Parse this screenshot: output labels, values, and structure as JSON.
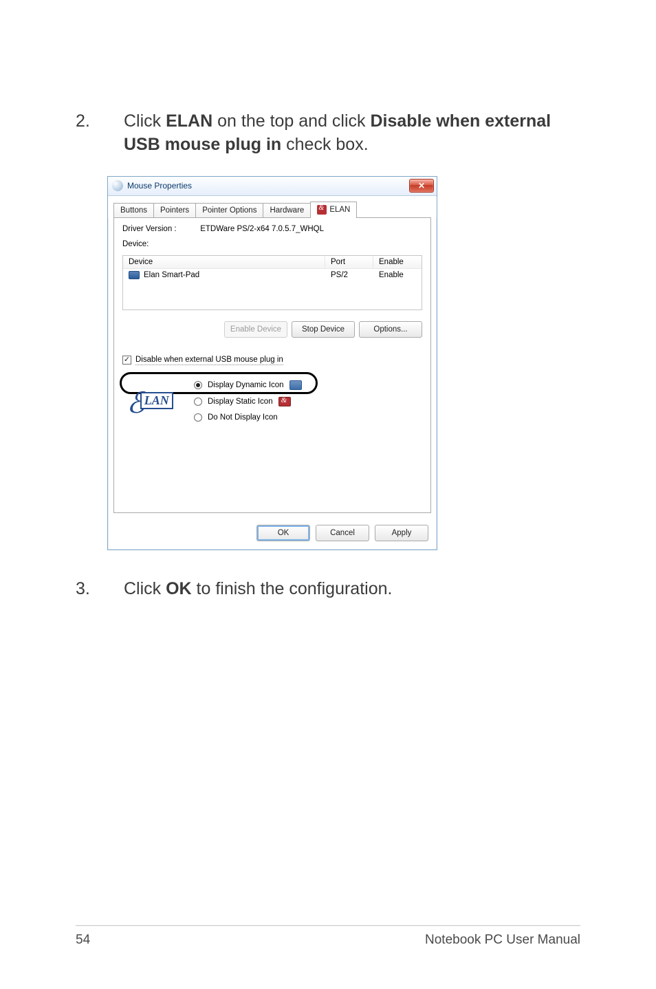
{
  "step2": {
    "num": "2.",
    "pre": "Click ",
    "b1": "ELAN",
    "mid": " on the top and click ",
    "b2": "Disable when external USB mouse plug in",
    "post": " check box."
  },
  "step3": {
    "num": "3.",
    "pre": "Click ",
    "b1": "OK",
    "post": " to finish the configuration."
  },
  "dialog": {
    "title": "Mouse Properties",
    "close_glyph": "✕",
    "tabs": {
      "buttons": "Buttons",
      "pointers": "Pointers",
      "pointer_options": "Pointer Options",
      "hardware": "Hardware",
      "elan": "ELAN"
    },
    "driver_version_label": "Driver Version :",
    "driver_version_value": "ETDWare PS/2-x64 7.0.5.7_WHQL",
    "device_label": "Device:",
    "columns": {
      "device": "Device",
      "port": "Port",
      "enable": "Enable"
    },
    "row": {
      "name": "Elan Smart-Pad",
      "port": "PS/2",
      "enable": "Enable"
    },
    "buttons_row": {
      "enable_device": "Enable Device",
      "stop_device": "Stop Device",
      "options": "Options..."
    },
    "checkbox_label": "Disable when external USB mouse plug in",
    "radios": {
      "dynamic": "Display Dynamic Icon",
      "static": "Display Static Icon",
      "none": "Do Not Display Icon"
    },
    "action_buttons": {
      "ok": "OK",
      "cancel": "Cancel",
      "apply": "Apply"
    },
    "logo_word": "LAN"
  },
  "footer": {
    "page": "54",
    "title": "Notebook PC User Manual"
  }
}
